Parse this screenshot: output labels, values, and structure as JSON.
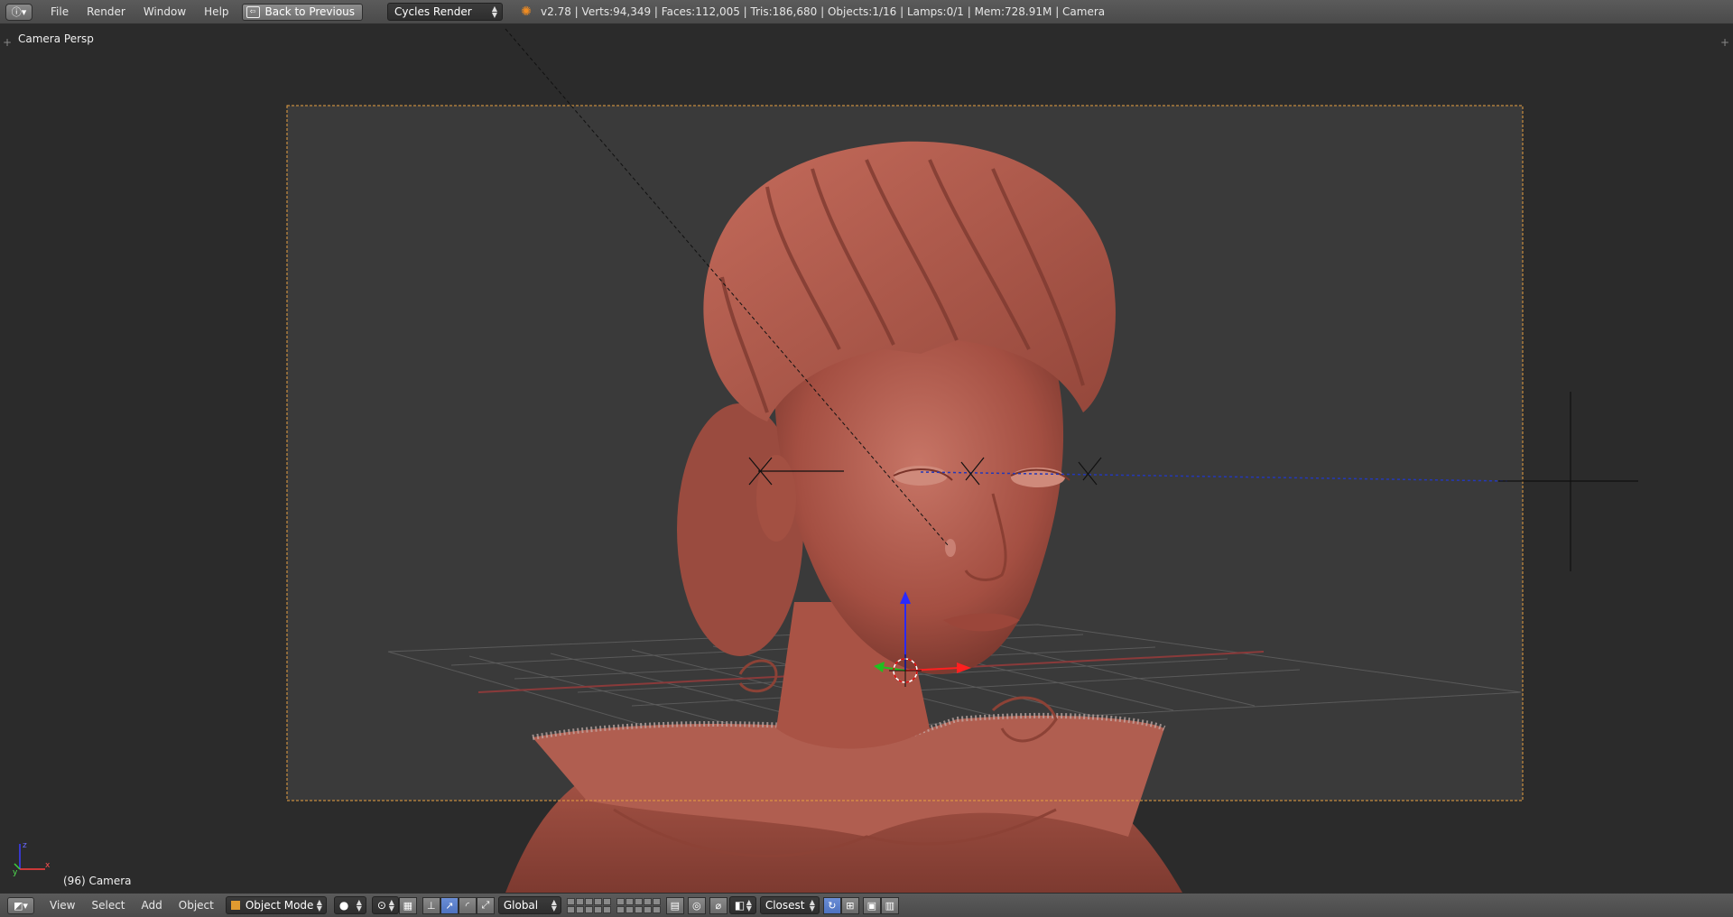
{
  "topbar": {
    "menus": [
      "File",
      "Render",
      "Window",
      "Help"
    ],
    "back_button": "Back to Previous",
    "render_engine": "Cycles Render",
    "stats": "v2.78 | Verts:94,349 | Faces:112,005 | Tris:186,680 | Objects:1/16 | Lamps:0/1 | Mem:728.91M | Camera"
  },
  "viewport": {
    "view_name": "Camera Persp",
    "active_object": "(96) Camera"
  },
  "bottombar": {
    "menus": [
      "View",
      "Select",
      "Add",
      "Object"
    ],
    "mode": "Object Mode",
    "orientation": "Global",
    "snap_target": "Closest"
  },
  "colors": {
    "header_bg": "#4f4f4f",
    "viewport_bg": "#2b2b2b",
    "camera_frame": "#e8a040",
    "model_skin": "#b25a4c",
    "accent_blue": "#5680c2"
  }
}
